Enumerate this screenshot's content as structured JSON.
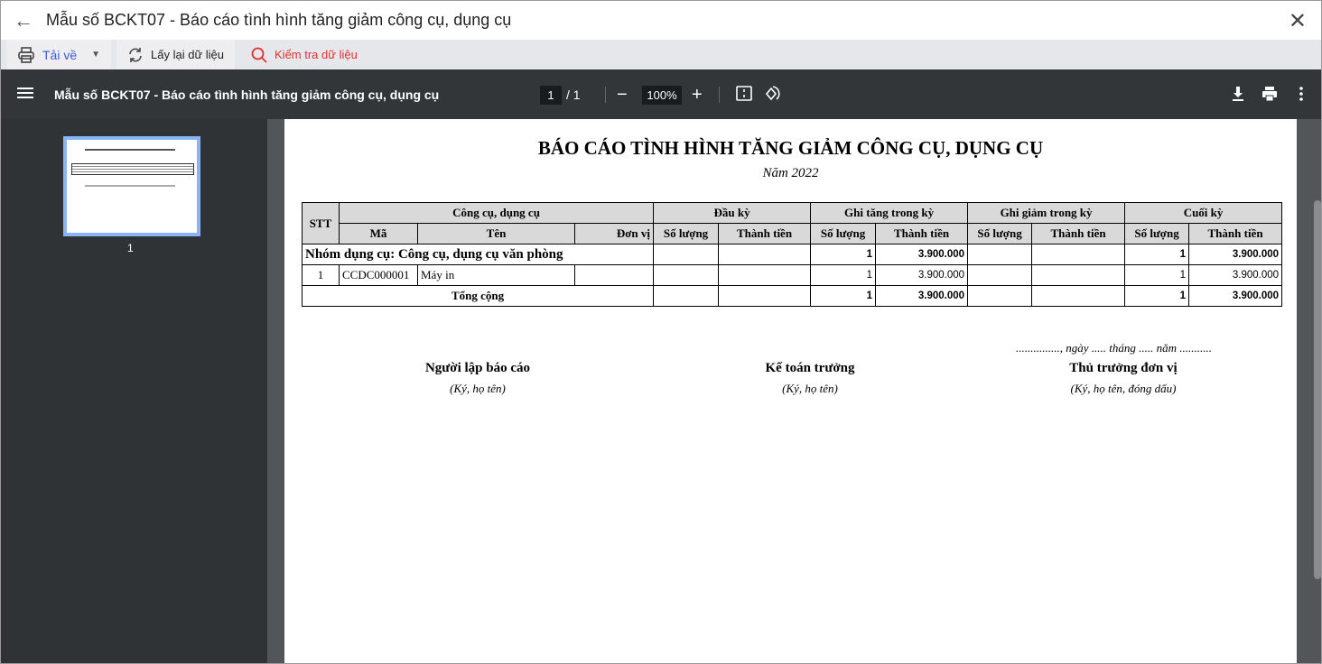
{
  "window": {
    "title": "Mẫu số BCKT07 - Báo cáo tình hình tăng giảm công cụ, dụng cụ"
  },
  "toolbar": {
    "download": "Tải về",
    "reload": "Lấy lại dữ liệu",
    "check": "Kiểm tra dữ liệu"
  },
  "viewer": {
    "title": "Mẫu số BCKT07 - Báo cáo tình hình tăng giảm công cụ, dụng cụ",
    "page": "1",
    "total": "/  1",
    "zoom": "100%",
    "thumb_label": "1"
  },
  "report": {
    "title": "BÁO CÁO TÌNH HÌNH TĂNG GIẢM CÔNG CỤ, DỤNG CỤ",
    "year": "Năm 2022",
    "headers": {
      "stt": "STT",
      "tool": "Công cụ, dụng cụ",
      "code": "Mã",
      "name": "Tên",
      "unit": "Đơn vị",
      "open": "Đầu kỳ",
      "inc": "Ghi tăng trong kỳ",
      "dec": "Ghi giảm trong kỳ",
      "close": "Cuối kỳ",
      "qty": "Số lượng",
      "amount": "Thành tiền"
    },
    "group": {
      "label": "Nhóm dụng cụ: Công cụ, dụng cụ văn phòng",
      "inc_qty": "1",
      "inc_amount": "3.900.000",
      "close_qty": "1",
      "close_amount": "3.900.000"
    },
    "rows": [
      {
        "stt": "1",
        "code": "CCDC000001",
        "name": "Máy in",
        "unit": "",
        "open_qty": "",
        "open_amount": "",
        "inc_qty": "1",
        "inc_amount": "3.900.000",
        "dec_qty": "",
        "dec_amount": "",
        "close_qty": "1",
        "close_amount": "3.900.000"
      }
    ],
    "total": {
      "label": "Tổng cộng",
      "inc_qty": "1",
      "inc_amount": "3.900.000",
      "close_qty": "1",
      "close_amount": "3.900.000"
    },
    "date_line": "..............., ngày ..... tháng ..... năm ...........",
    "signatures": [
      {
        "title": "Người lập báo cáo",
        "note": "(Ký, họ tên)"
      },
      {
        "title": "Kế toán trưởng",
        "note": "(Ký, họ tên)"
      },
      {
        "title": "Thủ trưởng đơn vị",
        "note": "(Ký, họ tên, đóng dấu)"
      }
    ]
  }
}
